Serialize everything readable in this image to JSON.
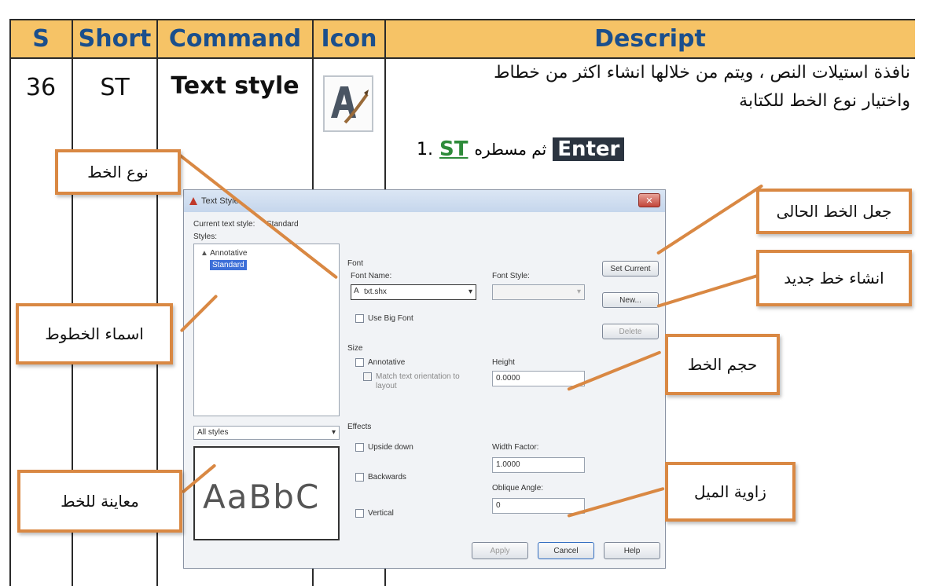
{
  "table": {
    "headers": {
      "s": "S",
      "short": "Short",
      "command": "Command",
      "icon": "Icon",
      "descript": "Descript"
    },
    "row": {
      "s": "36",
      "short": "ST",
      "command": "Text style",
      "icon": "text-style-icon",
      "description_line1": "نافذة استيلات النص ، ويتم من خلالها انشاء اكثر من خطاط",
      "description_line2": "واختيار نوع الخط للكتابة",
      "step_number": "1.",
      "step_shortcut": "ST",
      "step_text": "ثم مسطره",
      "step_key": "Enter"
    }
  },
  "callouts": {
    "font_type": "نوع الخط",
    "set_current": "جعل الخط الحالى",
    "new_font": "انشاء خط جديد",
    "font_names": "اسماء الخطوط",
    "font_size": "حجم الخط",
    "preview": "معاينة للخط",
    "oblique": "زاوية الميل"
  },
  "dialog": {
    "title": "Text Style",
    "current_label": "Current text style:",
    "current_value": "Standard",
    "styles_label": "Styles:",
    "styles": [
      "Annotative",
      "Standard"
    ],
    "filter_value": "All styles",
    "preview_text": "AaBbC",
    "font_group": "Font",
    "font_name_label": "Font Name:",
    "font_name_value": "txt.shx",
    "font_style_label": "Font Style:",
    "use_big_font": "Use Big Font",
    "size_group": "Size",
    "annotative": "Annotative",
    "match_orientation": "Match text orientation to layout",
    "height_label": "Height",
    "height_value": "0.0000",
    "effects_group": "Effects",
    "upside_down": "Upside down",
    "backwards": "Backwards",
    "vertical": "Vertical",
    "width_factor_label": "Width Factor:",
    "width_factor_value": "1.0000",
    "oblique_label": "Oblique Angle:",
    "oblique_value": "0",
    "buttons": {
      "set_current": "Set Current",
      "new": "New...",
      "delete": "Delete",
      "apply": "Apply",
      "cancel": "Cancel",
      "help": "Help"
    }
  },
  "colors": {
    "header_bg": "#f6c366",
    "header_text": "#1b4f8c",
    "callout_border": "#d98843",
    "shortcut_green": "#2e8b3a"
  }
}
